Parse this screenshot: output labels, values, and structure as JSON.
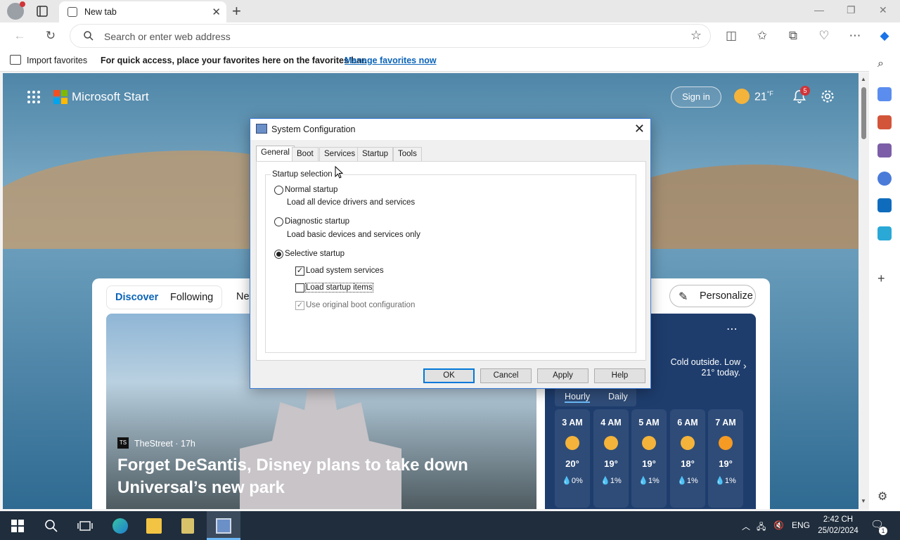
{
  "browser": {
    "tab_title": "New tab",
    "address_placeholder": "Search or enter web address"
  },
  "favorites_bar": {
    "import_label": "Import favorites",
    "message": "For quick access, place your favorites here on the favorites bar.",
    "manage_link": "Manage favorites now"
  },
  "msn": {
    "brand": "Microsoft Start",
    "sign_in": "Sign in",
    "temperature": "21",
    "temperature_unit": "°F",
    "notification_count": "5",
    "feed_tabs": [
      "Discover",
      "Following",
      "Ne"
    ],
    "personalize": "Personalize",
    "hero": {
      "source_logo": "TS",
      "source": "TheStreet · 17h",
      "headline": "Forget DeSantis, Disney plans to take down Universal’s new park"
    },
    "weather": {
      "summary": "Cold outside. Low 21° today.",
      "tabs": [
        "Hourly",
        "Daily"
      ],
      "hours": [
        {
          "time": "3 AM",
          "temp": "20°",
          "precip": "0%"
        },
        {
          "time": "4 AM",
          "temp": "19°",
          "precip": "1%"
        },
        {
          "time": "5 AM",
          "temp": "19°",
          "precip": "1%"
        },
        {
          "time": "6 AM",
          "temp": "18°",
          "precip": "1%"
        },
        {
          "time": "7 AM",
          "temp": "19°",
          "precip": "1%"
        }
      ]
    }
  },
  "dialog": {
    "title": "System Configuration",
    "tabs": [
      "General",
      "Boot",
      "Services",
      "Startup",
      "Tools"
    ],
    "group_label": "Startup selection",
    "normal": {
      "label": "Normal startup",
      "desc": "Load all device drivers and services"
    },
    "diagnostic": {
      "label": "Diagnostic startup",
      "desc": "Load basic devices and services only"
    },
    "selective": {
      "label": "Selective startup"
    },
    "options": [
      "Load system services",
      "Load startup items",
      "Use original boot configuration"
    ],
    "buttons": {
      "ok": "OK",
      "cancel": "Cancel",
      "apply": "Apply",
      "help": "Help"
    }
  },
  "taskbar": {
    "language": "ENG",
    "time": "2:42 CH",
    "date": "25/02/2024",
    "notif_count": "1"
  },
  "colors": {
    "accent": "#0078d7",
    "link": "#0a63b8",
    "taskbar": "#1f2d3d",
    "weather_card": "#1e3d6d"
  }
}
